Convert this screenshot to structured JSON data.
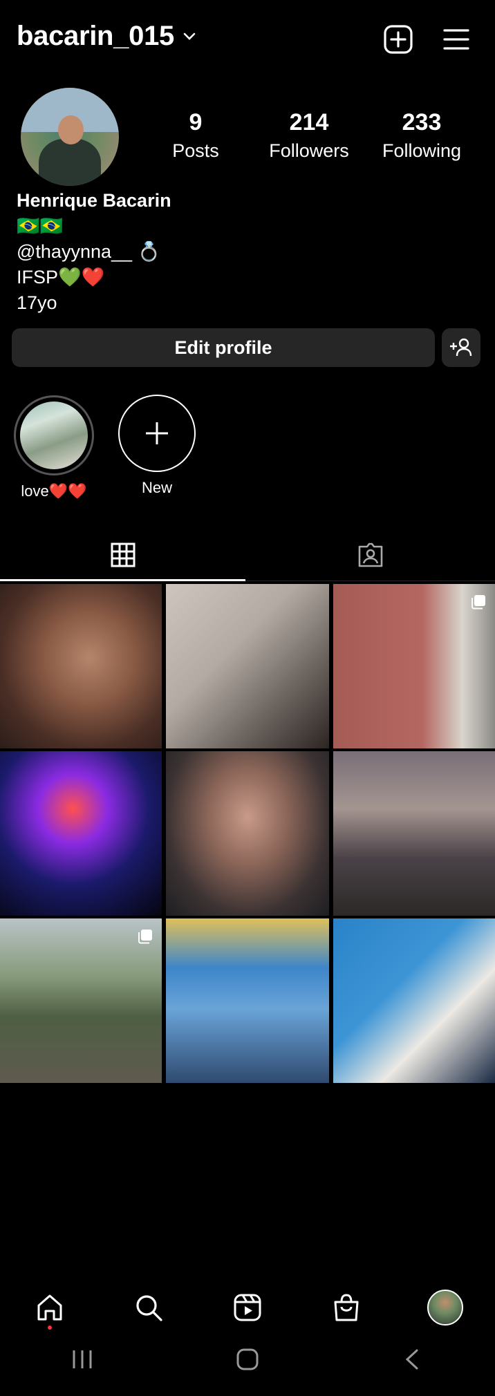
{
  "header": {
    "username": "bacarin_015"
  },
  "profile": {
    "stats": [
      {
        "value": "9",
        "label": "Posts"
      },
      {
        "value": "214",
        "label": "Followers"
      },
      {
        "value": "233",
        "label": "Following"
      }
    ],
    "name": "Henrique Bacarin",
    "bio_lines": [
      "🇧🇷🇧🇷",
      "@thayynna__ 💍",
      "IFSP💚❤️",
      "17yo"
    ]
  },
  "actions": {
    "edit_profile": "Edit profile"
  },
  "highlights": [
    {
      "label": "love❤️❤️"
    },
    {
      "label": "New"
    }
  ],
  "grid": {
    "posts": [
      {
        "desc": "girl-portrait"
      },
      {
        "desc": "brazil-jersey",
        "multi": false
      },
      {
        "desc": "couple-formal",
        "multi": true
      },
      {
        "desc": "ferris-wheel"
      },
      {
        "desc": "selfie-boy"
      },
      {
        "desc": "couple-night"
      },
      {
        "desc": "boy-bench",
        "multi": true
      },
      {
        "desc": "boy-classroom"
      },
      {
        "desc": "boy-uniform"
      }
    ]
  },
  "colors": {
    "background": "#000000",
    "button": "#262626",
    "accent_dot": "#ff3040"
  }
}
